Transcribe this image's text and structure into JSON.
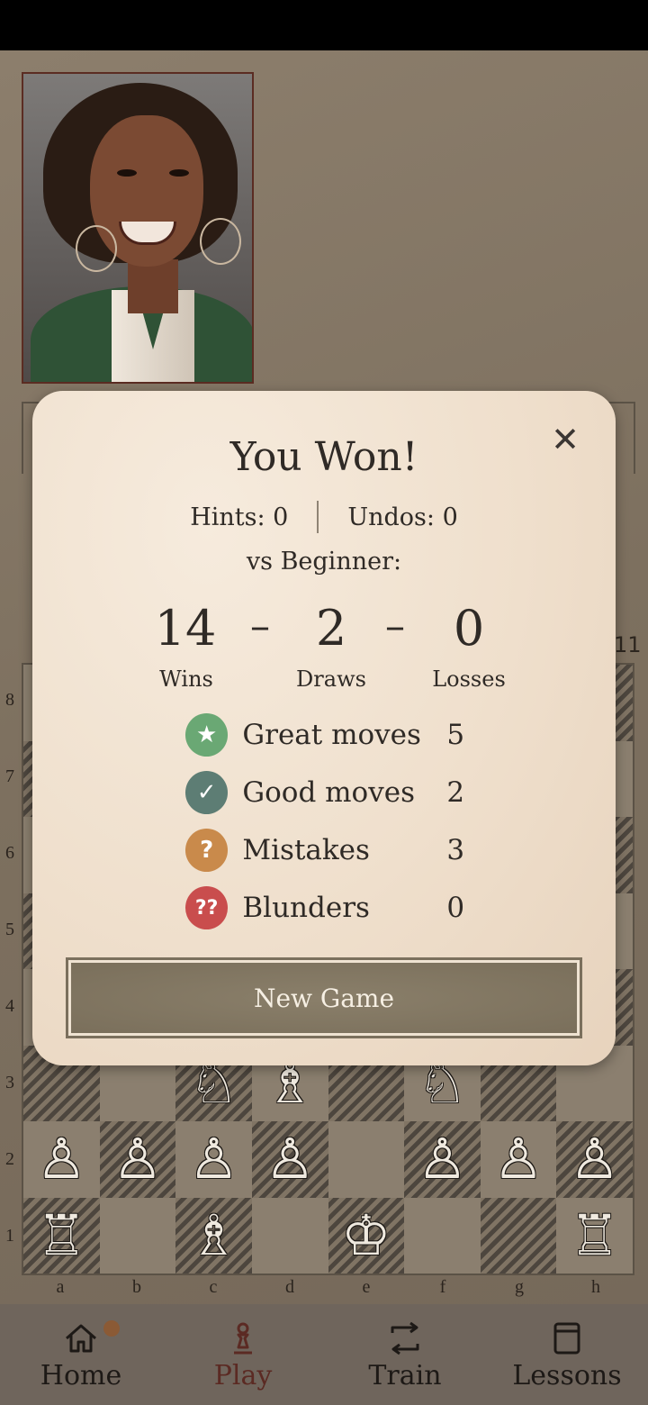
{
  "modal": {
    "title": "You Won!",
    "close_icon": "close-icon",
    "hints_label": "Hints: 0",
    "undos_label": "Undos: 0",
    "vs_label": "vs Beginner:",
    "record": {
      "wins": "14",
      "draws": "2",
      "losses": "0",
      "dash": "–",
      "wins_label": "Wins",
      "draws_label": "Draws",
      "losses_label": "Losses"
    },
    "stats": [
      {
        "label": "Great moves",
        "value": "5",
        "icon": "star-icon",
        "glyph": "★",
        "color": "#6aa874"
      },
      {
        "label": "Good moves",
        "value": "2",
        "icon": "check-icon",
        "glyph": "✓",
        "color": "#5d7d74"
      },
      {
        "label": "Mistakes",
        "value": "3",
        "icon": "question-icon",
        "glyph": "?",
        "color": "#c98a4b"
      },
      {
        "label": "Blunders",
        "value": "0",
        "icon": "double-question-icon",
        "glyph": "??",
        "color": "#c94d4d"
      }
    ],
    "new_game_label": "New Game"
  },
  "board": {
    "clock_label": "11",
    "ranks": [
      "8",
      "7",
      "6",
      "5",
      "4",
      "3",
      "2",
      "1"
    ],
    "files": [
      "a",
      "b",
      "c",
      "d",
      "e",
      "f",
      "g",
      "h"
    ],
    "visible_pieces": [
      {
        "square": "c3",
        "piece": "white-knight",
        "glyph": "♘"
      },
      {
        "square": "d3",
        "piece": "white-bishop",
        "glyph": "♗"
      },
      {
        "square": "f3",
        "piece": "white-knight",
        "glyph": "♘"
      },
      {
        "square": "a2",
        "piece": "white-pawn",
        "glyph": "♙"
      },
      {
        "square": "b2",
        "piece": "white-pawn",
        "glyph": "♙"
      },
      {
        "square": "c2",
        "piece": "white-pawn",
        "glyph": "♙"
      },
      {
        "square": "d2",
        "piece": "white-pawn",
        "glyph": "♙"
      },
      {
        "square": "f2",
        "piece": "white-pawn",
        "glyph": "♙"
      },
      {
        "square": "g2",
        "piece": "white-pawn",
        "glyph": "♙"
      },
      {
        "square": "h2",
        "piece": "white-pawn",
        "glyph": "♙"
      },
      {
        "square": "a1",
        "piece": "white-rook",
        "glyph": "♖"
      },
      {
        "square": "c1",
        "piece": "white-bishop",
        "glyph": "♗"
      },
      {
        "square": "e1",
        "piece": "white-king",
        "glyph": "♔"
      },
      {
        "square": "h1",
        "piece": "white-rook",
        "glyph": "♖"
      }
    ]
  },
  "nav": {
    "items": [
      {
        "label": "Home",
        "icon": "home-icon",
        "active": false
      },
      {
        "label": "Play",
        "icon": "pawn-icon",
        "active": true
      },
      {
        "label": "Train",
        "icon": "swap-icon",
        "active": false
      },
      {
        "label": "Lessons",
        "icon": "book-icon",
        "active": false
      }
    ]
  },
  "colors": {
    "modal_bg": "#efdfcc",
    "active_tab": "#5b2a23",
    "notification_dot": "#8b5a35"
  }
}
